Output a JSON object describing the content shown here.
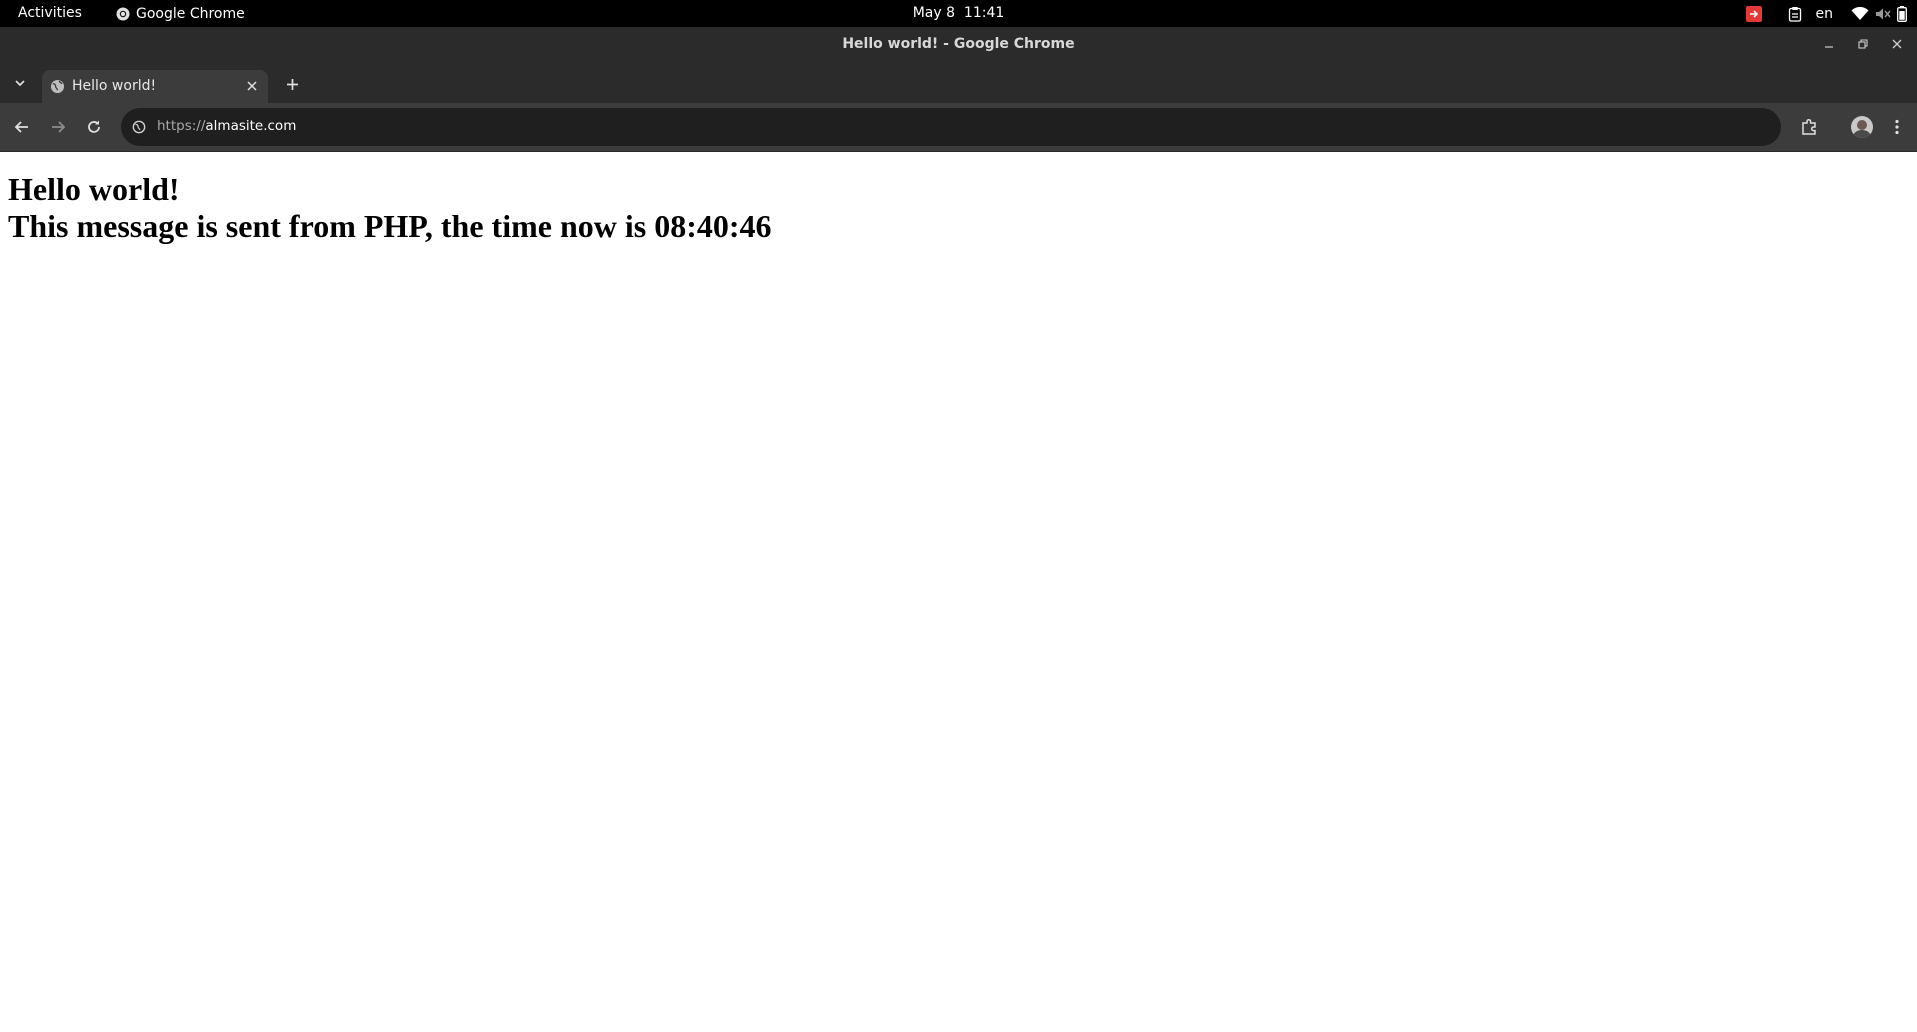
{
  "system_bar": {
    "activities": "Activities",
    "app_name": "Google Chrome",
    "clock": "May 8  11:41",
    "language": "en"
  },
  "window": {
    "title": "Hello world! - Google Chrome"
  },
  "tabs": [
    {
      "title": "Hello world!"
    }
  ],
  "address_bar": {
    "scheme": "https://",
    "host": "almasite.com"
  },
  "page": {
    "heading": "Hello world!",
    "message": "This message is sent from PHP, the time now is 08:40:46"
  },
  "icons": {
    "chrome": "chrome-icon",
    "screen_share": "screen-share-icon",
    "clipboard": "clipboard-icon",
    "wifi": "wifi-icon",
    "volume": "volume-muted-icon",
    "battery": "battery-icon",
    "minimize": "minimize-icon",
    "restore": "restore-icon",
    "close": "close-icon",
    "tab_search": "chevron-down-icon",
    "favicon": "globe-icon",
    "new_tab": "plus-icon",
    "back": "back-arrow-icon",
    "forward": "forward-arrow-icon",
    "reload": "reload-icon",
    "site_info": "site-info-icon",
    "extensions": "extensions-icon",
    "profile": "avatar",
    "menu": "kebab-menu-icon"
  },
  "colors": {
    "system_bar": "#000000",
    "chrome_frame": "#2b2b2b",
    "active_tab": "#3c3c3c",
    "omnibox": "#1f1f1f",
    "screen_share_indicator": "#e53935",
    "page_background": "#ffffff"
  }
}
